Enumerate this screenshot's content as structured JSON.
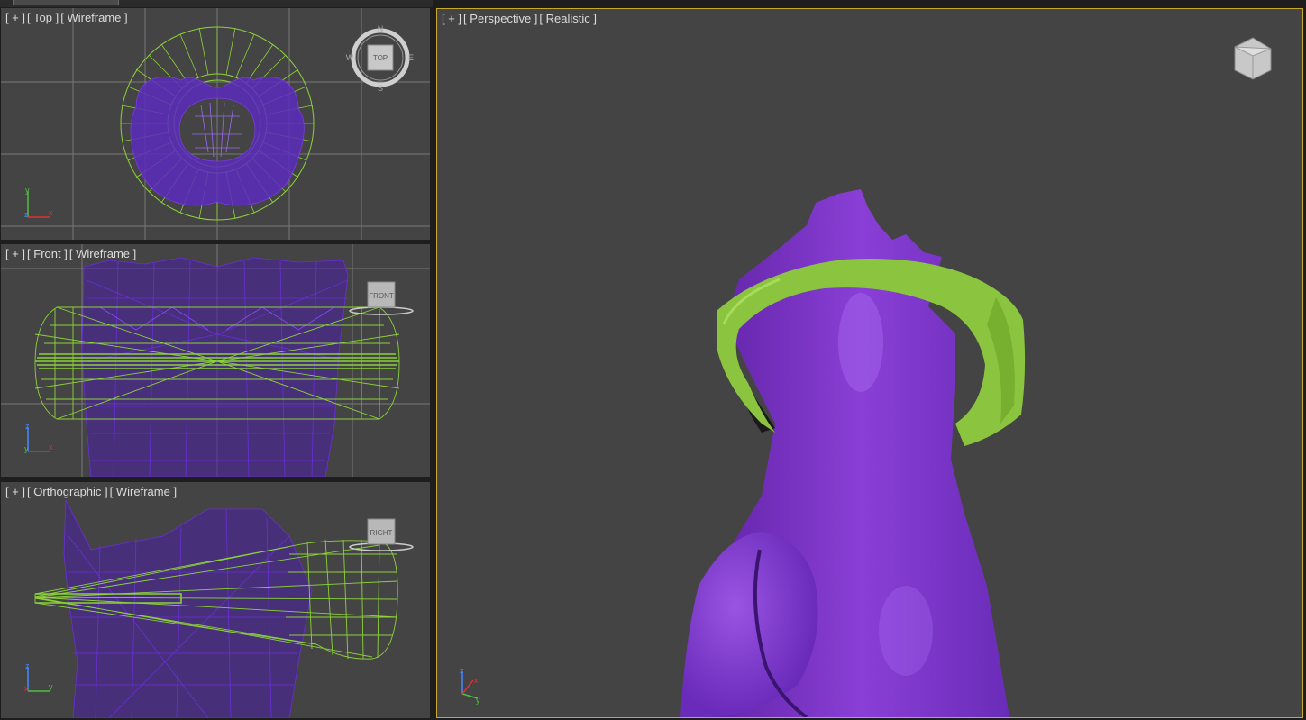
{
  "viewports": {
    "top": {
      "plus": "[ + ]",
      "view": "[ Top ]",
      "shading": "[ Wireframe ]",
      "cube_label": "TOP"
    },
    "front": {
      "plus": "[ + ]",
      "view": "[ Front ]",
      "shading": "[ Wireframe ]",
      "cube_label": "FRONT"
    },
    "ortho": {
      "plus": "[ + ]",
      "view": "[ Orthographic ]",
      "shading": "[ Wireframe ]",
      "cube_label": "RIGHT"
    },
    "perspective": {
      "plus": "[ + ]",
      "view": "[ Perspective ]",
      "shading": "[ Realistic ]"
    }
  },
  "compass": {
    "n": "N",
    "s": "S",
    "e": "E",
    "w": "W"
  },
  "axes": {
    "x": "x",
    "y": "y",
    "z": "z"
  },
  "colors": {
    "viewport_bg": "#444444",
    "active_border": "#c9a82b",
    "mesh_body": "#6e2fc4",
    "mesh_skirt": "#8bd23a",
    "grid": "#6a6a6a"
  }
}
